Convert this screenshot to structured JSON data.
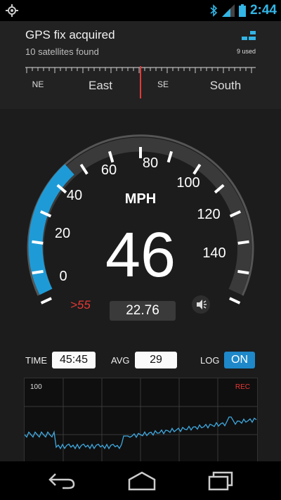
{
  "status_bar": {
    "time": "2:44"
  },
  "header": {
    "title": "GPS fix acquired",
    "subtitle": "10 satellites found",
    "satellites_used": "9 used"
  },
  "compass": {
    "labels": [
      "NE",
      "East",
      "SE",
      "South"
    ]
  },
  "speedometer": {
    "unit": "MPH",
    "speed": "46",
    "ticks": [
      "0",
      "20",
      "40",
      "60",
      "80",
      "100",
      "120",
      "140"
    ],
    "speed_limit": ">55",
    "odometer": "22.76"
  },
  "controls": {
    "time_label": "TIME",
    "time_value": "45:45",
    "avg_label": "AVG",
    "avg_value": "29",
    "log_label": "LOG",
    "log_value": "ON"
  },
  "graph": {
    "max_label": "100",
    "rec_label": "REC"
  },
  "colors": {
    "accent": "#33b5e5",
    "limit": "#e53935",
    "on_button": "#1e88c9"
  }
}
